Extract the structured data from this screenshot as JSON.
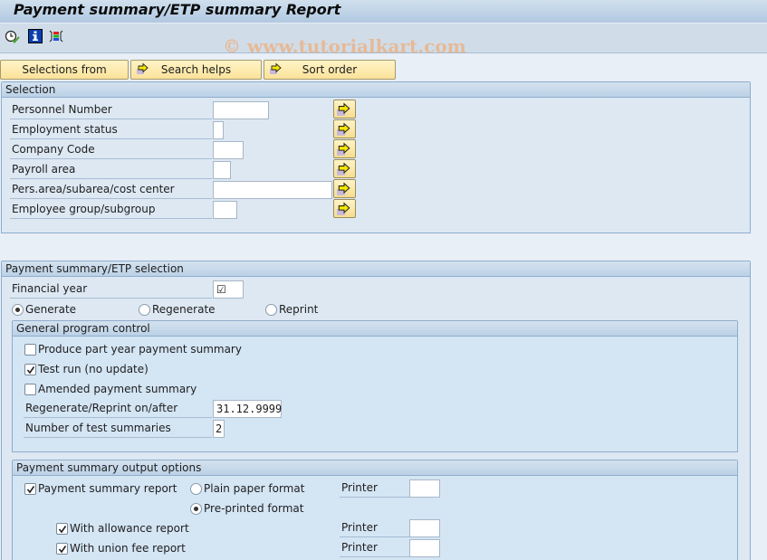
{
  "window": {
    "title": "Payment summary/ETP summary Report",
    "watermark": "© www.tutorialkart.com"
  },
  "toolbar": {
    "icons": [
      "execute-clock-icon",
      "info-icon",
      "layout-colors-icon"
    ]
  },
  "appbar": {
    "buttons": [
      {
        "label": "Selections from"
      },
      {
        "label": "Search helps"
      },
      {
        "label": "Sort order"
      }
    ]
  },
  "selection": {
    "title": "Selection",
    "fields": [
      {
        "label": "Personnel Number",
        "value": ""
      },
      {
        "label": "Employment status",
        "value": ""
      },
      {
        "label": "Company Code",
        "value": ""
      },
      {
        "label": "Payroll area",
        "value": ""
      },
      {
        "label": "Pers.area/subarea/cost center",
        "value": ""
      },
      {
        "label": "Employee group/subgroup",
        "value": ""
      }
    ]
  },
  "etp": {
    "title": "Payment summary/ETP selection",
    "financial_year_label": "Financial year",
    "financial_year_value": "☑",
    "radios": [
      {
        "label": "Generate",
        "selected": true
      },
      {
        "label": "Regenerate",
        "selected": false
      },
      {
        "label": "Reprint",
        "selected": false
      }
    ],
    "general": {
      "title": "General program control",
      "checkboxes": [
        {
          "label": "Produce part year payment summary",
          "checked": false
        },
        {
          "label": "Test run (no update)",
          "checked": true
        },
        {
          "label": "Amended payment summary",
          "checked": false
        }
      ],
      "regen_label": "Regenerate/Reprint on/after",
      "regen_value": "31.12.9999",
      "num_label": "Number of test summaries",
      "num_value": "2"
    },
    "output": {
      "title": "Payment summary output options",
      "payment_report_label": "Payment summary report",
      "payment_report_checked": true,
      "plain_label": "Plain paper format",
      "plain_selected": false,
      "preprinted_label": "Pre-printed format",
      "preprinted_selected": true,
      "allowance_label": "With allowance report",
      "allowance_checked": true,
      "union_label": "With union fee report",
      "union_checked": true,
      "printer_label": "Printer",
      "printer_values": [
        "",
        "",
        ""
      ]
    }
  }
}
